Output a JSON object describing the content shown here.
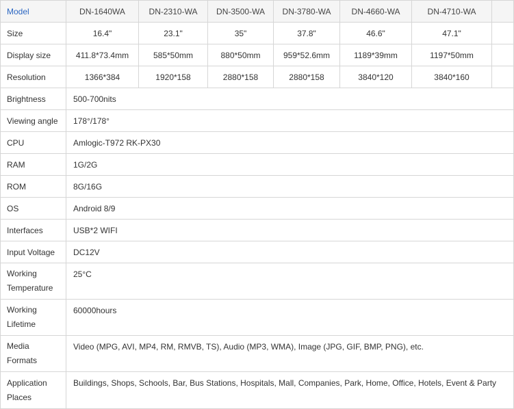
{
  "header": {
    "model_label": "Model",
    "models": [
      "DN-1640WA",
      "DN-2310-WA",
      "DN-3500-WA",
      "DN-3780-WA",
      "DN-4660-WA",
      "DN-4710-WA"
    ]
  },
  "rows_per_model": [
    {
      "label": "Size",
      "values": [
        "16.4\"",
        "23.1\"",
        "35\"",
        "37.8\"",
        "46.6\"",
        "47.1\""
      ]
    },
    {
      "label": "Display size",
      "values": [
        "411.8*73.4mm",
        "585*50mm",
        "880*50mm",
        "959*52.6mm",
        "1189*39mm",
        "1197*50mm"
      ]
    },
    {
      "label": "Resolution",
      "values": [
        "1366*384",
        "1920*158",
        "2880*158",
        "2880*158",
        "3840*120",
        "3840*160"
      ]
    }
  ],
  "rows_shared": [
    {
      "label": "Brightness",
      "value": "500-700nits"
    },
    {
      "label": "Viewing angle",
      "value": "178°/178°"
    },
    {
      "label": "CPU",
      "value": "Amlogic-T972 RK-PX30"
    },
    {
      "label": "RAM",
      "value": "1G/2G"
    },
    {
      "label": "ROM",
      "value": "8G/16G"
    },
    {
      "label": "OS",
      "value": "Android 8/9"
    },
    {
      "label": "Interfaces",
      "value": "USB*2 WIFI"
    },
    {
      "label": "Input Voltage",
      "value": "DC12V"
    }
  ],
  "rows_tall": [
    {
      "label_line1": "Working",
      "label_line2": "Temperature",
      "value": "25°C"
    },
    {
      "label_line1": "Working",
      "label_line2": "Lifetime",
      "value": "60000hours"
    },
    {
      "label_line1": "Media",
      "label_line2": "Formats",
      "value": "Video (MPG, AVI, MP4, RM, RMVB, TS), Audio (MP3, WMA), Image (JPG, GIF, BMP, PNG), etc."
    },
    {
      "label_line1": "Application",
      "label_line2": "Places",
      "value": "Buildings, Shops, Schools, Bar, Bus Stations, Hospitals, Mall, Companies, Park, Home, Office, Hotels, Event & Party"
    }
  ]
}
